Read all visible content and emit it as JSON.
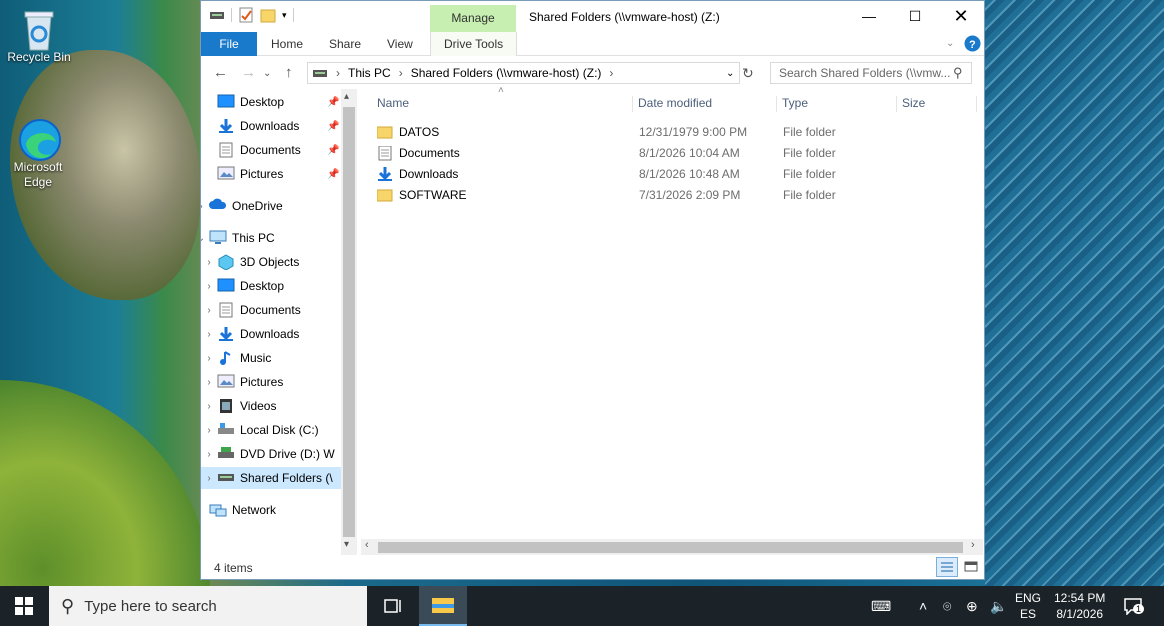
{
  "desktop": {
    "icons": [
      {
        "label": "Recycle Bin",
        "icon": "recycle-bin-icon"
      },
      {
        "label": "Microsoft Edge",
        "icon": "edge-icon"
      }
    ]
  },
  "window": {
    "title": "Shared Folders (\\\\vmware-host) (Z:)",
    "contextual_tab_group": "Manage",
    "ribbon_tabs": [
      "File",
      "Home",
      "Share",
      "View",
      "Drive Tools"
    ],
    "address": {
      "crumbs": [
        "This PC",
        "Shared Folders (\\\\vmware-host) (Z:)"
      ]
    },
    "search_placeholder": "Search Shared Folders (\\\\vmw...",
    "nav_pane": {
      "quick_access": [
        "Desktop",
        "Downloads",
        "Documents",
        "Pictures"
      ],
      "onedrive": "OneDrive",
      "this_pc": "This PC",
      "this_pc_children": [
        "3D Objects",
        "Desktop",
        "Documents",
        "Downloads",
        "Music",
        "Pictures",
        "Videos",
        "Local Disk (C:)",
        "DVD Drive (D:) W",
        "Shared Folders (\\"
      ],
      "network": "Network"
    },
    "columns": {
      "name": "Name",
      "date": "Date modified",
      "type": "Type",
      "size": "Size"
    },
    "files": [
      {
        "name": "DATOS",
        "date": "12/31/1979 9:00 PM",
        "type": "File folder",
        "icon": "folder-icon"
      },
      {
        "name": "Documents",
        "date": "8/1/2026 10:04 AM",
        "type": "File folder",
        "icon": "documents-icon"
      },
      {
        "name": "Downloads",
        "date": "8/1/2026 10:48 AM",
        "type": "File folder",
        "icon": "downloads-icon"
      },
      {
        "name": "SOFTWARE",
        "date": "7/31/2026 2:09 PM",
        "type": "File folder",
        "icon": "folder-icon"
      }
    ],
    "status": "4 items"
  },
  "taskbar": {
    "search_placeholder": "Type here to search",
    "lang_top": "ENG",
    "lang_bottom": "ES",
    "time": "12:54 PM",
    "date": "8/1/2026",
    "notification_count": "1"
  }
}
